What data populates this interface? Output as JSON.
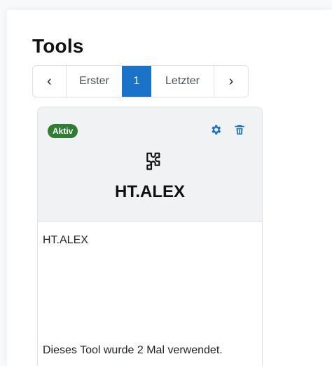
{
  "page": {
    "title": "Tools"
  },
  "pagination": {
    "prev_icon": "chevron-left-icon",
    "prev_glyph": "‹",
    "first_label": "Erster",
    "current_page": "1",
    "last_label": "Letzter",
    "next_icon": "chevron-right-icon",
    "next_glyph": "›",
    "active_color": "#1a73c8"
  },
  "tool_card": {
    "status_badge": "Aktiv",
    "status_color": "#2e7d32",
    "settings_icon": "gear-icon",
    "delete_icon": "trash-icon",
    "tool_icon": "puzzle-piece-icon",
    "name": "HT.ALEX",
    "description": "HT.ALEX",
    "usage_text": "Dieses Tool wurde 2 Mal verwendet.",
    "action_color": "#1a73c8"
  }
}
